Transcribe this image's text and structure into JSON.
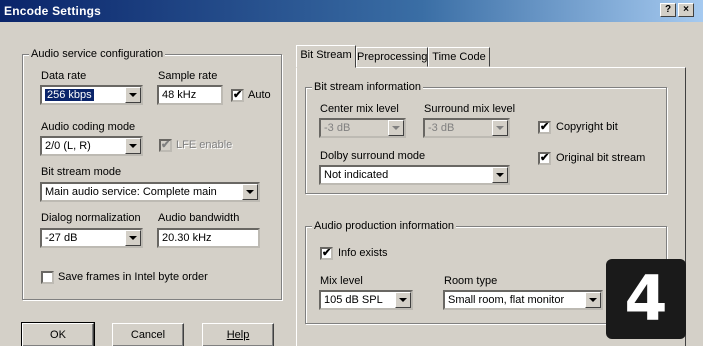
{
  "window": {
    "title": "Encode Settings",
    "help_glyph": "?",
    "close_glyph": "×"
  },
  "audio_config": {
    "legend": "Audio service configuration",
    "data_rate": {
      "label": "Data rate",
      "value": "256 kbps"
    },
    "sample_rate": {
      "label": "Sample rate",
      "value": "48 kHz"
    },
    "auto": {
      "label": "Auto",
      "checked": true
    },
    "coding_mode": {
      "label": "Audio coding mode",
      "value": "2/0 (L, R)"
    },
    "lfe": {
      "label": "LFE enable",
      "checked": true,
      "enabled": false
    },
    "bit_stream_mode": {
      "label": "Bit stream mode",
      "value": "Main audio service: Complete main"
    },
    "dialog_norm": {
      "label": "Dialog normalization",
      "value": "-27 dB"
    },
    "bandwidth": {
      "label": "Audio bandwidth",
      "value": "20.30 kHz"
    },
    "save_frames": {
      "label": "Save frames in Intel byte order",
      "checked": false
    }
  },
  "buttons": {
    "ok": "OK",
    "cancel": "Cancel",
    "help": "Help"
  },
  "tabs": [
    {
      "label": "Bit Stream",
      "active": true
    },
    {
      "label": "Preprocessing",
      "active": false
    },
    {
      "label": "Time Code",
      "active": false
    }
  ],
  "bit_stream_info": {
    "legend": "Bit stream information",
    "center_mix": {
      "label": "Center mix level",
      "value": "-3 dB"
    },
    "surround_mix": {
      "label": "Surround mix level",
      "value": "-3 dB"
    },
    "copyright": {
      "label": "Copyright bit",
      "checked": true
    },
    "dolby_surround": {
      "label": "Dolby surround mode",
      "value": "Not indicated"
    },
    "original": {
      "label": "Original bit stream",
      "checked": true
    }
  },
  "production_info": {
    "legend": "Audio production information",
    "info_exists": {
      "label": "Info exists",
      "checked": true
    },
    "mix_level": {
      "label": "Mix level",
      "value": "105 dB SPL"
    },
    "room_type": {
      "label": "Room type",
      "value": "Small room, flat monitor"
    }
  },
  "badge": {
    "text": "4"
  },
  "check_glyph": "✔"
}
